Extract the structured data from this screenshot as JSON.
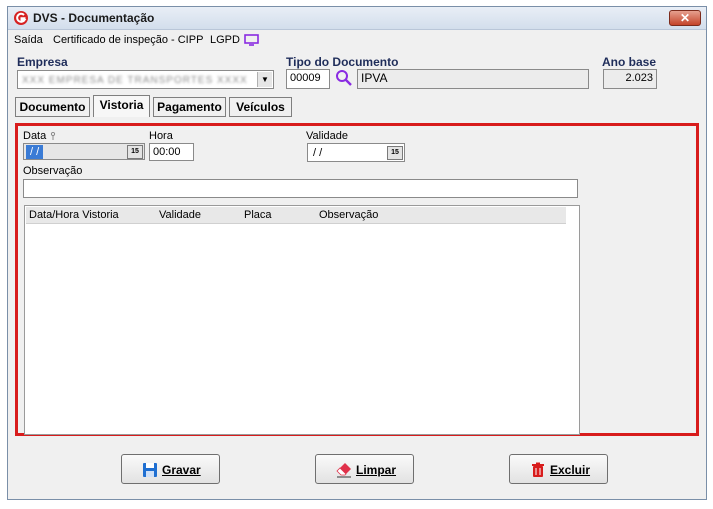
{
  "window": {
    "title": "DVS - Documentação",
    "close_glyph": "✕"
  },
  "menu": {
    "items": [
      "Saída",
      "Certificado de inspeção - CIPP",
      "LGPD"
    ]
  },
  "header": {
    "empresa_label": "Empresa",
    "empresa_value": "XXX EMPRESA DE TRANSPORTES XXXX",
    "tipo_label": "Tipo do Documento",
    "tipo_code": "00009",
    "tipo_name": "IPVA",
    "ano_label": "Ano base",
    "ano_value": "2.023"
  },
  "tabs": [
    {
      "label": "Documento",
      "active": false
    },
    {
      "label": "Vistoria",
      "active": true
    },
    {
      "label": "Pagamento",
      "active": false
    },
    {
      "label": "Veículos",
      "active": false
    }
  ],
  "vistoria": {
    "data_label": "Data",
    "data_value": "/ /",
    "hora_label": "Hora",
    "hora_value": "00:00",
    "validade_label": "Validade",
    "validade_value": "/ /",
    "observacao_label": "Observação",
    "observacao_value": "",
    "calendar_glyph": "15",
    "grid_columns": [
      "Data/Hora Vistoria",
      "Validade",
      "Placa",
      "Observação"
    ],
    "grid_rows": []
  },
  "buttons": {
    "gravar": "Gravar",
    "limpar": "Limpar",
    "excluir": "Excluir"
  },
  "colors": {
    "accent_red": "#d81c1c",
    "icon_purple": "#8a2be2",
    "title_blue": "#1f2d5a"
  }
}
